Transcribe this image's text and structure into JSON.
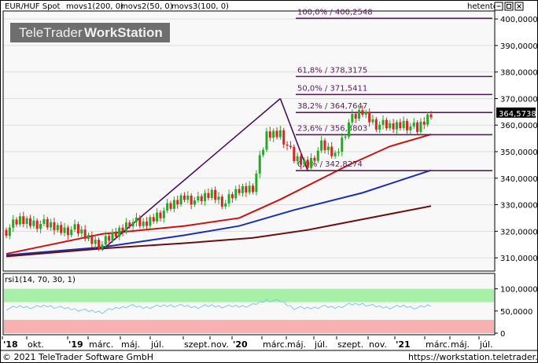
{
  "header": {
    "title": "EUR/HUF Spot",
    "indicators": [
      {
        "label": "movs1(200, 0)",
        "color": "#cc1111"
      },
      {
        "label": "movs2(50, 0)",
        "color": "#1a2fb0"
      },
      {
        "label": "movs3(100, 0)",
        "color": "#6b1010"
      }
    ],
    "period": "hetente",
    "logo_text_1": "TeleTrader",
    "logo_text_2": "WorkStation"
  },
  "price_axis": {
    "ylim": [
      305000,
      403000
    ],
    "ticks": [
      "400,0000",
      "390,0000",
      "380,0000",
      "370,0000",
      "360,0000",
      "350,0000",
      "340,0000",
      "330,0000",
      "320,0000",
      "310,0000"
    ],
    "current_value_label": "364,5738"
  },
  "fibonacci": {
    "levels": [
      {
        "label": "100,0% / 400,2548",
        "value": 400254.8
      },
      {
        "label": "61,8% / 378,3175",
        "value": 378317.5
      },
      {
        "label": "50,0% / 371,5411",
        "value": 371541.1
      },
      {
        "label": "38,2% / 364,7647",
        "value": 364764.7
      },
      {
        "label": "23,6% / 356,3803",
        "value": 356380.3
      },
      {
        "label": "0,0% / 342,8274",
        "value": 342827.4
      }
    ]
  },
  "rsi_panel": {
    "title": "rsi1(14, 70, 30, 1)",
    "ticks": [
      "100,0000",
      "50,0000",
      "0"
    ],
    "ylim": [
      0,
      110
    ]
  },
  "x_axis": {
    "labels": [
      {
        "text": "'18",
        "bold": true
      },
      {
        "text": "okt.",
        "bold": false
      },
      {
        "text": "'19",
        "bold": true
      },
      {
        "text": "márc.",
        "bold": false
      },
      {
        "text": "máj.",
        "bold": false
      },
      {
        "text": "júl.",
        "bold": false
      },
      {
        "text": "szept.",
        "bold": false
      },
      {
        "text": "nov.",
        "bold": false
      },
      {
        "text": "'20",
        "bold": true
      },
      {
        "text": "márc.",
        "bold": false
      },
      {
        "text": "máj.",
        "bold": false
      },
      {
        "text": "júl.",
        "bold": false
      },
      {
        "text": "szept.",
        "bold": false
      },
      {
        "text": "nov.",
        "bold": false
      },
      {
        "text": "'21",
        "bold": true
      },
      {
        "text": "márc.",
        "bold": false
      },
      {
        "text": "máj.",
        "bold": false
      },
      {
        "text": "júl.",
        "bold": false
      }
    ]
  },
  "footer": {
    "copyright": "© 2021 TeleTrader Software GmbH",
    "url": "https://workstation.teletrader.com"
  },
  "chart_data": {
    "type": "candlestick",
    "title": "EUR/HUF Spot",
    "frequency": "weekly",
    "price_series": [
      {
        "date": "2018-08",
        "close": 320.5
      },
      {
        "date": "2018-09",
        "close": 324.0
      },
      {
        "date": "2018-10",
        "close": 323.5
      },
      {
        "date": "2018-11",
        "close": 322.0
      },
      {
        "date": "2018-12",
        "close": 321.0
      },
      {
        "date": "2019-01",
        "close": 320.5
      },
      {
        "date": "2019-02",
        "close": 317.5
      },
      {
        "date": "2019-03",
        "close": 315.0
      },
      {
        "date": "2019-04",
        "close": 319.0
      },
      {
        "date": "2019-05",
        "close": 324.0
      },
      {
        "date": "2019-06",
        "close": 322.0
      },
      {
        "date": "2019-07",
        "close": 326.5
      },
      {
        "date": "2019-08",
        "close": 329.0
      },
      {
        "date": "2019-09",
        "close": 333.5
      },
      {
        "date": "2019-10",
        "close": 331.0
      },
      {
        "date": "2019-11",
        "close": 334.5
      },
      {
        "date": "2019-12",
        "close": 330.5
      },
      {
        "date": "2020-01",
        "close": 335.5
      },
      {
        "date": "2020-02",
        "close": 337.0
      },
      {
        "date": "2020-03",
        "close": 356.0
      },
      {
        "date": "2020-04",
        "close": 357.5
      },
      {
        "date": "2020-05",
        "close": 347.0
      },
      {
        "date": "2020-06",
        "close": 345.5
      },
      {
        "date": "2020-07",
        "close": 352.0
      },
      {
        "date": "2020-08",
        "close": 348.5
      },
      {
        "date": "2020-09",
        "close": 361.0
      },
      {
        "date": "2020-10",
        "close": 365.0
      },
      {
        "date": "2020-11",
        "close": 360.5
      },
      {
        "date": "2020-12",
        "close": 359.0
      },
      {
        "date": "2021-01",
        "close": 361.0
      },
      {
        "date": "2021-02",
        "close": 358.0
      },
      {
        "date": "2021-03",
        "close": 364.5738
      }
    ],
    "series": [
      {
        "name": "movs1(200, 0)",
        "color": "#cc1111",
        "values": [
          {
            "date": "2018-08",
            "y": 311.5
          },
          {
            "date": "2019-03",
            "y": 319.0
          },
          {
            "date": "2019-09",
            "y": 322.0
          },
          {
            "date": "2020-01",
            "y": 325.0
          },
          {
            "date": "2020-04",
            "y": 332.0
          },
          {
            "date": "2020-09",
            "y": 345.0
          },
          {
            "date": "2020-12",
            "y": 352.0
          },
          {
            "date": "2021-03",
            "y": 356.5
          }
        ]
      },
      {
        "name": "movs2(50, 0)",
        "color": "#1a2fb0",
        "values": [
          {
            "date": "2018-08",
            "y": 311.0
          },
          {
            "date": "2019-03",
            "y": 314.0
          },
          {
            "date": "2019-09",
            "y": 318.5
          },
          {
            "date": "2020-01",
            "y": 322.0
          },
          {
            "date": "2020-05",
            "y": 328.0
          },
          {
            "date": "2020-10",
            "y": 334.5
          },
          {
            "date": "2021-03",
            "y": 343.0
          }
        ]
      },
      {
        "name": "movs3(100, 0)",
        "color": "#6b1010",
        "values": [
          {
            "date": "2018-08",
            "y": 310.5
          },
          {
            "date": "2019-03",
            "y": 313.5
          },
          {
            "date": "2019-09",
            "y": 315.5
          },
          {
            "date": "2020-02",
            "y": 317.5
          },
          {
            "date": "2020-06",
            "y": 320.5
          },
          {
            "date": "2020-11",
            "y": 325.5
          },
          {
            "date": "2021-03",
            "y": 329.5
          }
        ]
      }
    ],
    "trendlines": [
      {
        "from": {
          "date": "2019-03",
          "y": 313.0
        },
        "to": {
          "date": "2020-04",
          "y": 370.0
        }
      },
      {
        "from": {
          "date": "2020-04",
          "y": 370.0
        },
        "to": {
          "date": "2020-06",
          "y": 342.8
        }
      }
    ],
    "ylim": [
      305,
      403
    ],
    "rsi": {
      "name": "rsi1(14, 70, 30, 1)",
      "overbought": 70,
      "oversold": 30,
      "ylim": [
        0,
        110
      ],
      "values": [
        55,
        60,
        58,
        62,
        57,
        54,
        50,
        48,
        56,
        62,
        58,
        60,
        63,
        61,
        59,
        62,
        60,
        61,
        63,
        75,
        72,
        57,
        56,
        60,
        58,
        64,
        66,
        60,
        58,
        61,
        57,
        63
      ]
    }
  }
}
